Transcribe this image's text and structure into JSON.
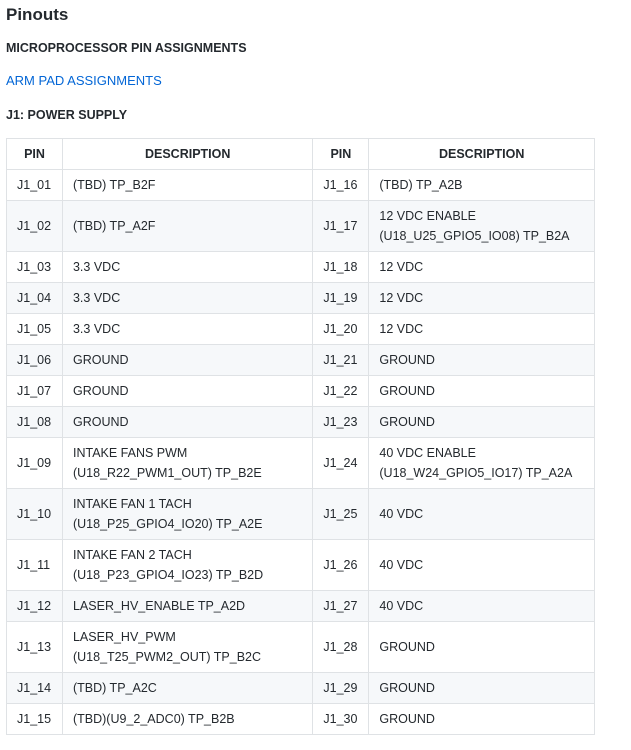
{
  "title": "Pinouts",
  "micro_heading": "MICROPROCESSOR PIN ASSIGNMENTS",
  "arm_link": "ARM PAD ASSIGNMENTS",
  "j1_heading": "J1: POWER SUPPLY",
  "table": {
    "headers": [
      "PIN",
      "DESCRIPTION",
      "PIN",
      "DESCRIPTION"
    ],
    "rows": [
      {
        "p1": "J1_01",
        "d1": [
          "(TBD) TP_B2F"
        ],
        "p2": "J1_16",
        "d2": [
          "(TBD) TP_A2B"
        ]
      },
      {
        "p1": "J1_02",
        "d1": [
          "(TBD) TP_A2F"
        ],
        "p2": "J1_17",
        "d2": [
          "12 VDC ENABLE",
          "(U18_U25_GPIO5_IO08) TP_B2A"
        ]
      },
      {
        "p1": "J1_03",
        "d1": [
          "3.3 VDC"
        ],
        "p2": "J1_18",
        "d2": [
          "12 VDC"
        ]
      },
      {
        "p1": "J1_04",
        "d1": [
          "3.3 VDC"
        ],
        "p2": "J1_19",
        "d2": [
          "12 VDC"
        ]
      },
      {
        "p1": "J1_05",
        "d1": [
          "3.3 VDC"
        ],
        "p2": "J1_20",
        "d2": [
          "12 VDC"
        ]
      },
      {
        "p1": "J1_06",
        "d1": [
          "GROUND"
        ],
        "p2": "J1_21",
        "d2": [
          "GROUND"
        ]
      },
      {
        "p1": "J1_07",
        "d1": [
          "GROUND"
        ],
        "p2": "J1_22",
        "d2": [
          "GROUND"
        ]
      },
      {
        "p1": "J1_08",
        "d1": [
          "GROUND"
        ],
        "p2": "J1_23",
        "d2": [
          "GROUND"
        ]
      },
      {
        "p1": "J1_09",
        "d1": [
          "INTAKE FANS PWM",
          "(U18_R22_PWM1_OUT) TP_B2E"
        ],
        "p2": "J1_24",
        "d2": [
          "40 VDC ENABLE",
          "(U18_W24_GPIO5_IO17) TP_A2A"
        ]
      },
      {
        "p1": "J1_10",
        "d1": [
          "INTAKE FAN 1 TACH",
          "(U18_P25_GPIO4_IO20) TP_A2E"
        ],
        "p2": "J1_25",
        "d2": [
          "40 VDC"
        ]
      },
      {
        "p1": "J1_11",
        "d1": [
          "INTAKE FAN 2 TACH",
          "(U18_P23_GPIO4_IO23) TP_B2D"
        ],
        "p2": "J1_26",
        "d2": [
          "40 VDC"
        ]
      },
      {
        "p1": "J1_12",
        "d1": [
          "LASER_HV_ENABLE TP_A2D"
        ],
        "p2": "J1_27",
        "d2": [
          "40 VDC"
        ]
      },
      {
        "p1": "J1_13",
        "d1": [
          "LASER_HV_PWM",
          "(U18_T25_PWM2_OUT) TP_B2C"
        ],
        "p2": "J1_28",
        "d2": [
          "GROUND"
        ]
      },
      {
        "p1": "J1_14",
        "d1": [
          "(TBD) TP_A2C"
        ],
        "p2": "J1_29",
        "d2": [
          "GROUND"
        ]
      },
      {
        "p1": "J1_15",
        "d1": [
          "(TBD)(U9_2_ADC0) TP_B2B"
        ],
        "p2": "J1_30",
        "d2": [
          "GROUND"
        ]
      }
    ]
  }
}
